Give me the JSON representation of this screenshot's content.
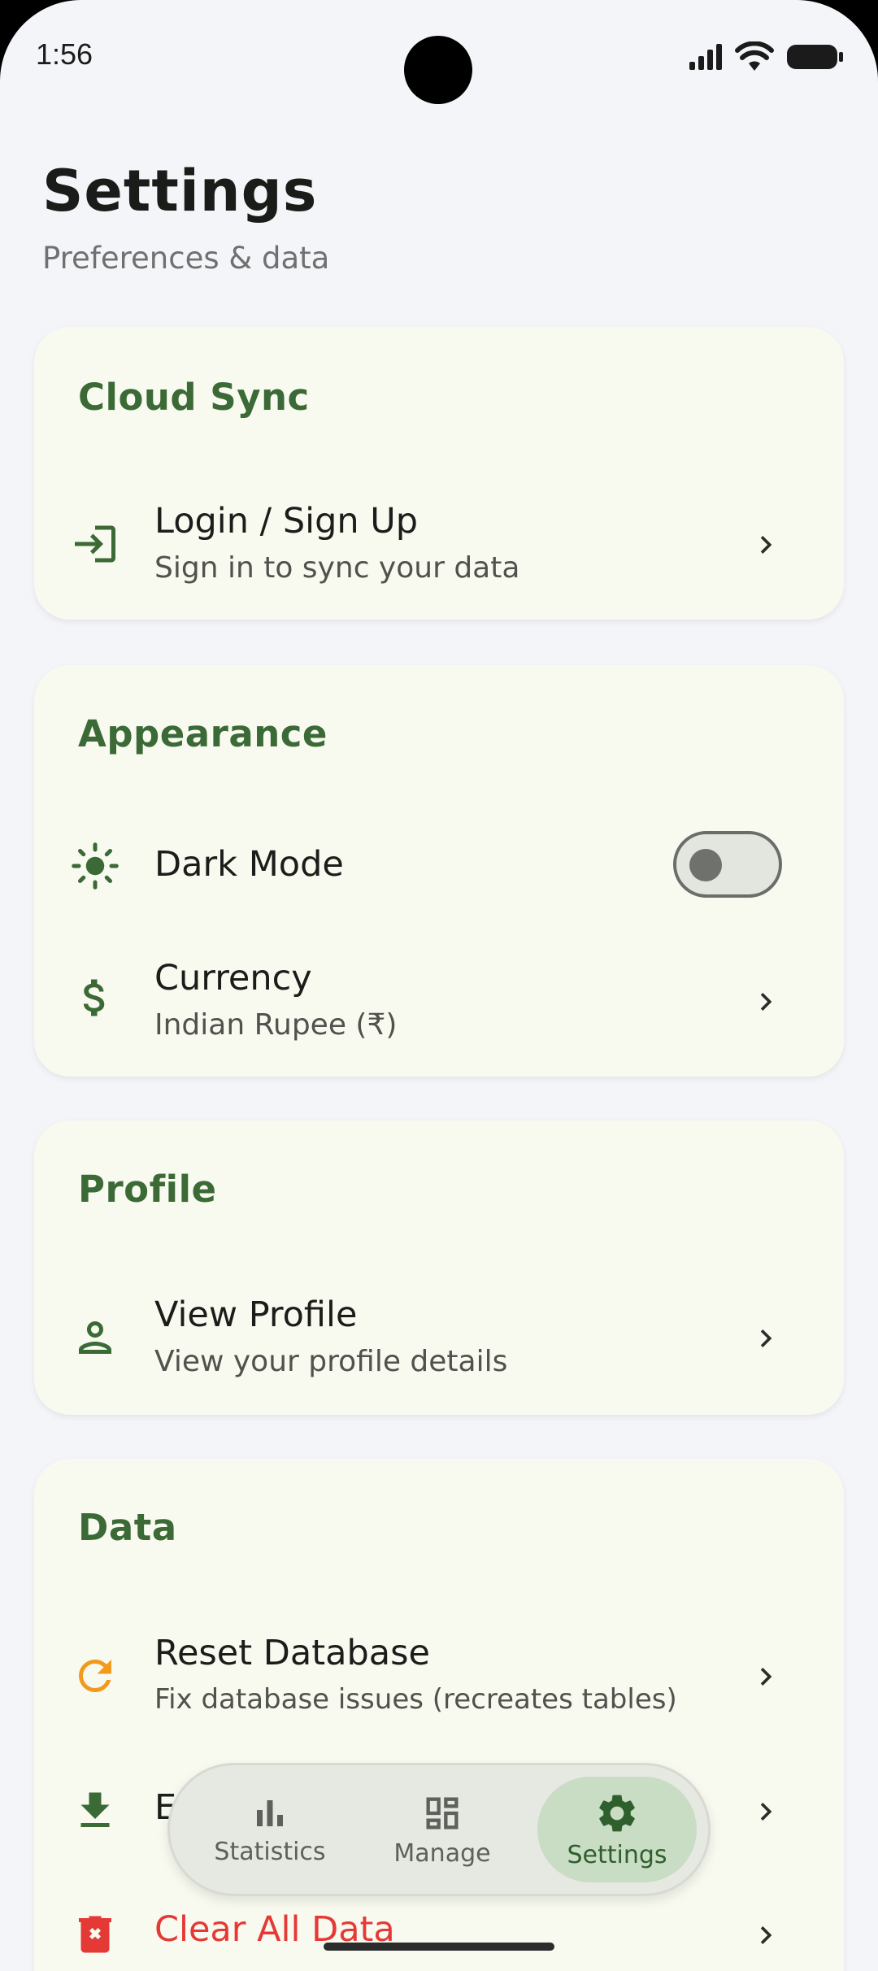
{
  "status_bar": {
    "time": "1:56"
  },
  "header": {
    "title": "Settings",
    "subtitle": "Preferences & data"
  },
  "sections": {
    "cloud_sync": {
      "title": "Cloud Sync",
      "login": {
        "label": "Login / Sign Up",
        "sub": "Sign in to sync your data",
        "icon": "login-icon"
      }
    },
    "appearance": {
      "title": "Appearance",
      "dark_mode": {
        "label": "Dark Mode",
        "enabled": false,
        "icon": "sun-icon"
      },
      "currency": {
        "label": "Currency",
        "sub": "Indian Rupee (₹)",
        "icon": "dollar-icon"
      }
    },
    "profile": {
      "title": "Profile",
      "view_profile": {
        "label": "View Profile",
        "sub": "View your profile details",
        "icon": "person-icon"
      }
    },
    "data": {
      "title": "Data",
      "reset": {
        "label": "Reset Database",
        "sub": "Fix database issues (recreates tables)",
        "icon": "refresh-icon"
      },
      "export": {
        "label": "E",
        "icon": "download-icon"
      },
      "clear": {
        "label": "Clear All Data",
        "icon": "delete-icon"
      }
    }
  },
  "bottom_nav": {
    "items": [
      {
        "label": "Statistics",
        "icon": "bar-chart-icon",
        "active": false
      },
      {
        "label": "Manage",
        "icon": "dashboard-icon",
        "active": false
      },
      {
        "label": "Settings",
        "icon": "gear-icon",
        "active": true
      }
    ]
  },
  "colors": {
    "accent_green": "#3b6a36",
    "warning_orange": "#f29a1c",
    "danger_red": "#e53935",
    "background": "#f4f5f9",
    "card": "#f8faf0"
  }
}
